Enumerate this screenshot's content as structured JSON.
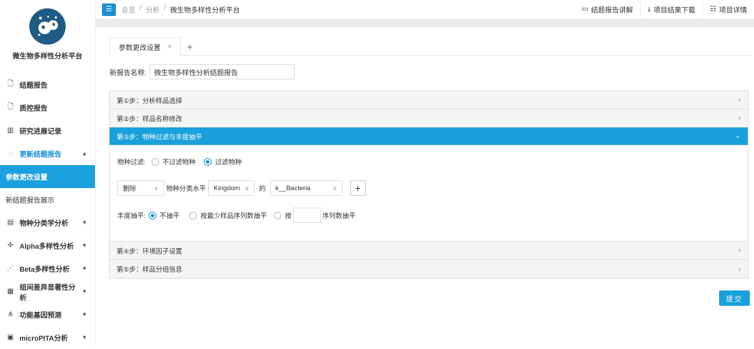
{
  "app": {
    "name": "微生物多样性分析平台"
  },
  "sidebar": {
    "items": [
      {
        "label": "结题报告",
        "icon": "document-icon"
      },
      {
        "label": "质控报告",
        "icon": "document-icon"
      },
      {
        "label": "研究进展记录",
        "icon": "chart-icon"
      },
      {
        "label": "更新结题报告",
        "icon": "refresh-icon"
      },
      {
        "label": "参数更改设置"
      },
      {
        "label": "新结题报告展示"
      },
      {
        "label": "物种分类学分析",
        "icon": "list-icon"
      },
      {
        "label": "Alpha多样性分析",
        "icon": "crosshair-icon"
      },
      {
        "label": "Beta多样性分析",
        "icon": "scatter-icon"
      },
      {
        "label": "组间差异显著性分析",
        "icon": "grid-icon"
      },
      {
        "label": "功能基因预测",
        "icon": "hierarchy-icon"
      },
      {
        "label": "microPITA分析",
        "icon": "panel-icon"
      }
    ]
  },
  "header": {
    "breadcrumb": [
      "总览",
      "分析",
      "微生物多样性分析平台"
    ],
    "actions": [
      "结题报告讲解",
      "项目结果下载",
      "项目详情"
    ]
  },
  "main": {
    "tab_label": "参数更改设置",
    "report_name_label": "新报告名称:",
    "report_name_value": "微生物多样性分析结题报告",
    "steps": [
      "第①步：分析样品选择",
      "第②步：样品名称修改",
      "第③步：物种过滤与丰度抽平",
      "第④步：环境因子设置",
      "第⑤步：样品分组信息"
    ],
    "filter": {
      "label": "物种过滤:",
      "option_no": "不过滤物种",
      "option_yes": "过滤物种"
    },
    "rule": {
      "action": "删除",
      "level_label": "物种分类水平",
      "level": "Kingdom",
      "of": "的",
      "taxon": "k__Bacteria"
    },
    "rarefy": {
      "label": "丰度抽平:",
      "opt1": "不抽平",
      "opt2": "按最少样品序列数抽平",
      "opt3_prefix": "按",
      "opt3_suffix": "序列数抽平"
    },
    "submit": "提交"
  }
}
